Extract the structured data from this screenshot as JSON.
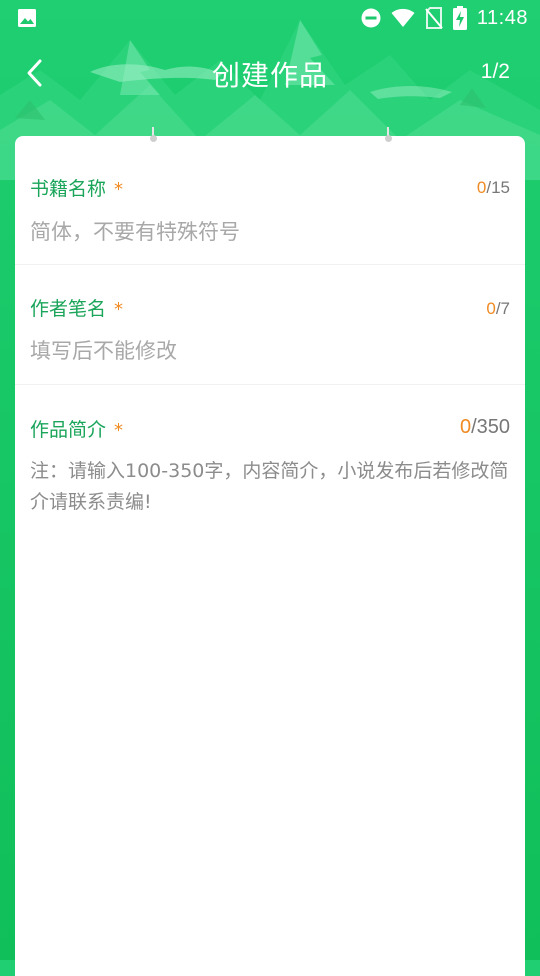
{
  "status_bar": {
    "time": "11:48",
    "icons": [
      "image-icon",
      "do-not-disturb-icon",
      "wifi-icon",
      "no-sim-icon",
      "battery-charging-icon"
    ]
  },
  "header": {
    "title": "创建作品",
    "step": "1/2",
    "back_icon": "chevron-left-icon"
  },
  "form": {
    "book_name": {
      "label": "书籍名称",
      "required_mark": "*",
      "count_current": "0",
      "count_max": "/15",
      "placeholder": "简体，不要有特殊符号",
      "value": ""
    },
    "pen_name": {
      "label": "作者笔名",
      "required_mark": "*",
      "count_current": "0",
      "count_max": "/7",
      "placeholder": "填写后不能修改",
      "value": ""
    },
    "synopsis": {
      "label": "作品简介",
      "required_mark": "*",
      "count_current": "0",
      "count_max": "/350",
      "placeholder": "注：请输入100-350字，内容简介，小说发布后若修改简介请联系责编!",
      "value": ""
    }
  },
  "colors": {
    "brand_green": "#18c766",
    "label_green": "#1aa55a",
    "accent_orange": "#f08a22",
    "placeholder_gray": "#a8a8a8"
  }
}
